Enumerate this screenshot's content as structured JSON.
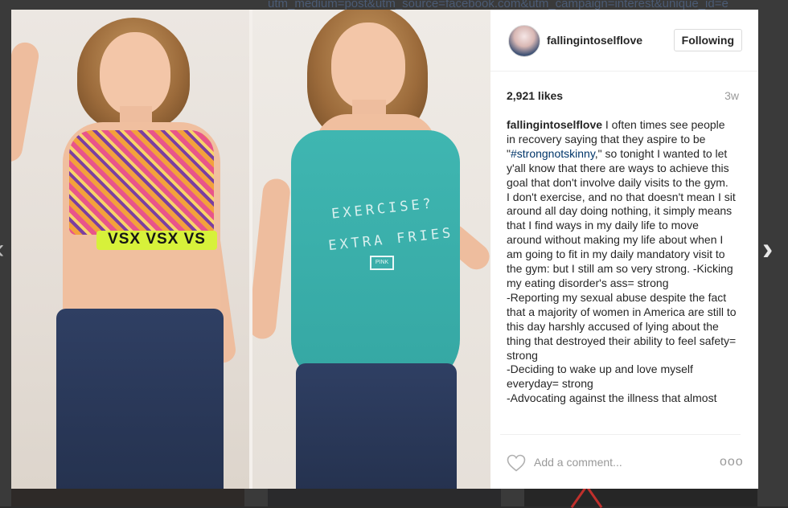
{
  "background": {
    "url_text": "utm_medium=post&utm_source=facebook.com&utm_campaign=interest&unique_id=e"
  },
  "nav": {
    "prev_icon": "chevron-left-icon",
    "next_icon": "chevron-right-icon",
    "prev_glyph": "‹",
    "next_glyph": "›"
  },
  "photo": {
    "left_band_text": "VSX  VSX  VS",
    "tank_line1": "EXERCISE?",
    "tank_line2": "EXTRA FRIES",
    "tank_tag": "PINK"
  },
  "post": {
    "username": "fallingintoselflove",
    "follow_label": "Following",
    "likes": "2,921 likes",
    "age": "3w",
    "caption_user": "fallingintoselflove",
    "caption_part1": " I often times see people in recovery saying that they aspire to be \"",
    "hashtag": "#strongnotskinny",
    "caption_part2": ",\" so tonight I wanted to let y'all know that there are ways to achieve this goal that don't involve daily visits to the gym.",
    "caption_p2": "I don't exercise, and no that doesn't mean I sit around all day doing nothing, it simply means that I find ways in my daily life to move around without making my life about when I am going to fit in my daily mandatory visit to the gym: but I still am so very strong. -Kicking my eating disorder's ass= strong",
    "caption_p3": "-Reporting my sexual abuse despite the fact that a majority of women in America are still to this day harshly accused of lying about the thing that destroyed their ability to feel safety= strong",
    "caption_p4": "-Deciding to wake up and love myself everyday= strong",
    "caption_p5": "-Advocating against the illness that almost"
  },
  "comment": {
    "placeholder": "Add a comment...",
    "more_glyph": "ooo",
    "heart_icon": "heart-icon",
    "more_icon": "more-options-icon"
  }
}
